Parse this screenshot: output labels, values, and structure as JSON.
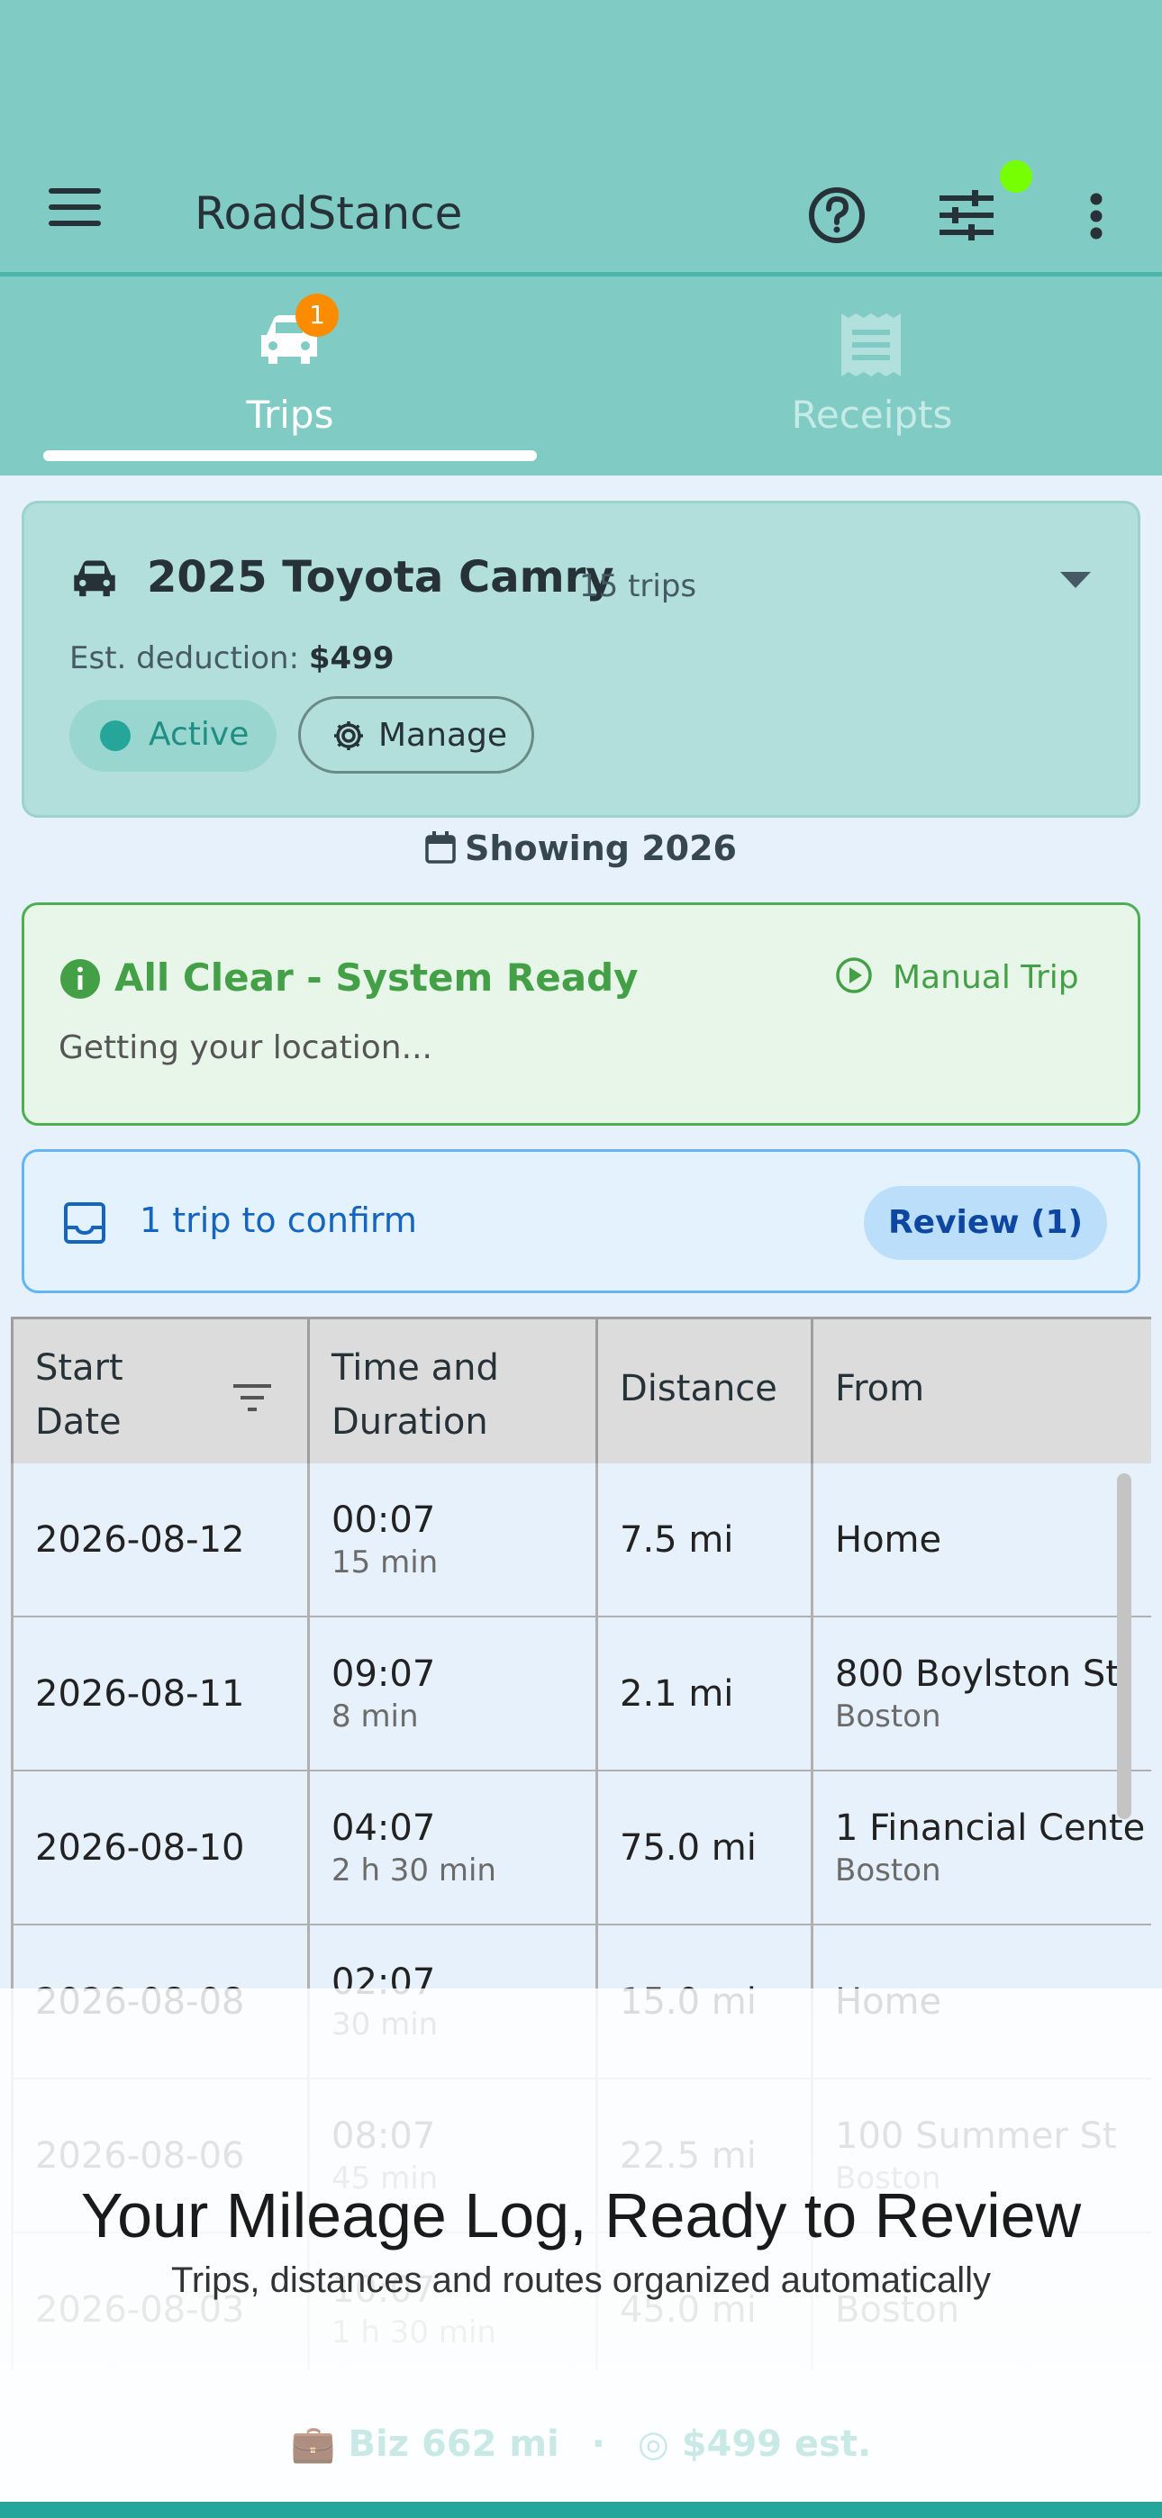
{
  "app": {
    "title": "RoadStance"
  },
  "tabs": [
    {
      "label": "Trips",
      "badge": "1",
      "icon": "car-icon",
      "selected": true
    },
    {
      "label": "Receipts",
      "icon": "receipt-icon",
      "selected": false
    }
  ],
  "vehicle": {
    "name": "2025 Toyota Camry",
    "trips": "15 trips",
    "deduction_label": "Est. deduction:",
    "deduction_value": "$499",
    "status": "Active",
    "manage_label": "Manage"
  },
  "filter": {
    "showing": "Showing 2026"
  },
  "status_card": {
    "title": "All Clear - System Ready",
    "action": "Manual Trip",
    "message": "Getting your location..."
  },
  "confirm_card": {
    "text": "1 trip to confirm",
    "button": "Review (1)"
  },
  "table": {
    "columns": [
      "Start Date",
      "Time and Duration",
      "Distance",
      "From"
    ],
    "rows": [
      {
        "date": "2026-08-12",
        "time": "00:07",
        "duration": "15 min",
        "distance": "7.5 mi",
        "from": "Home",
        "from_sub": ""
      },
      {
        "date": "2026-08-11",
        "time": "09:07",
        "duration": "8 min",
        "distance": "2.1 mi",
        "from": "800 Boylston St",
        "from_sub": "Boston"
      },
      {
        "date": "2026-08-10",
        "time": "04:07",
        "duration": "2 h 30 min",
        "distance": "75.0 mi",
        "from": "1 Financial Cente",
        "from_sub": "Boston"
      },
      {
        "date": "2026-08-08",
        "time": "02:07",
        "duration": "30 min",
        "distance": "15.0 mi",
        "from": "Home",
        "from_sub": ""
      },
      {
        "date": "2026-08-06",
        "time": "08:07",
        "duration": "45 min",
        "distance": "22.5 mi",
        "from": "100 Summer St",
        "from_sub": "Boston"
      },
      {
        "date": "2026-08-03",
        "time": "10:07",
        "duration": "1 h 30 min",
        "distance": "45.0 mi",
        "from": "Boston",
        "from_sub": ""
      }
    ]
  },
  "promo": {
    "title": "Your Mileage Log, Ready to Review",
    "subtitle": "Trips, distances and routes organized automatically"
  },
  "footer": {
    "business": "Biz 662 mi",
    "separator": "·",
    "estimate": "$499 est."
  },
  "colors": {
    "primary": "#80cbc4",
    "accent": "#26a69a",
    "success": "#4caf50",
    "info": "#1565c0",
    "badge": "#fb8c00"
  }
}
